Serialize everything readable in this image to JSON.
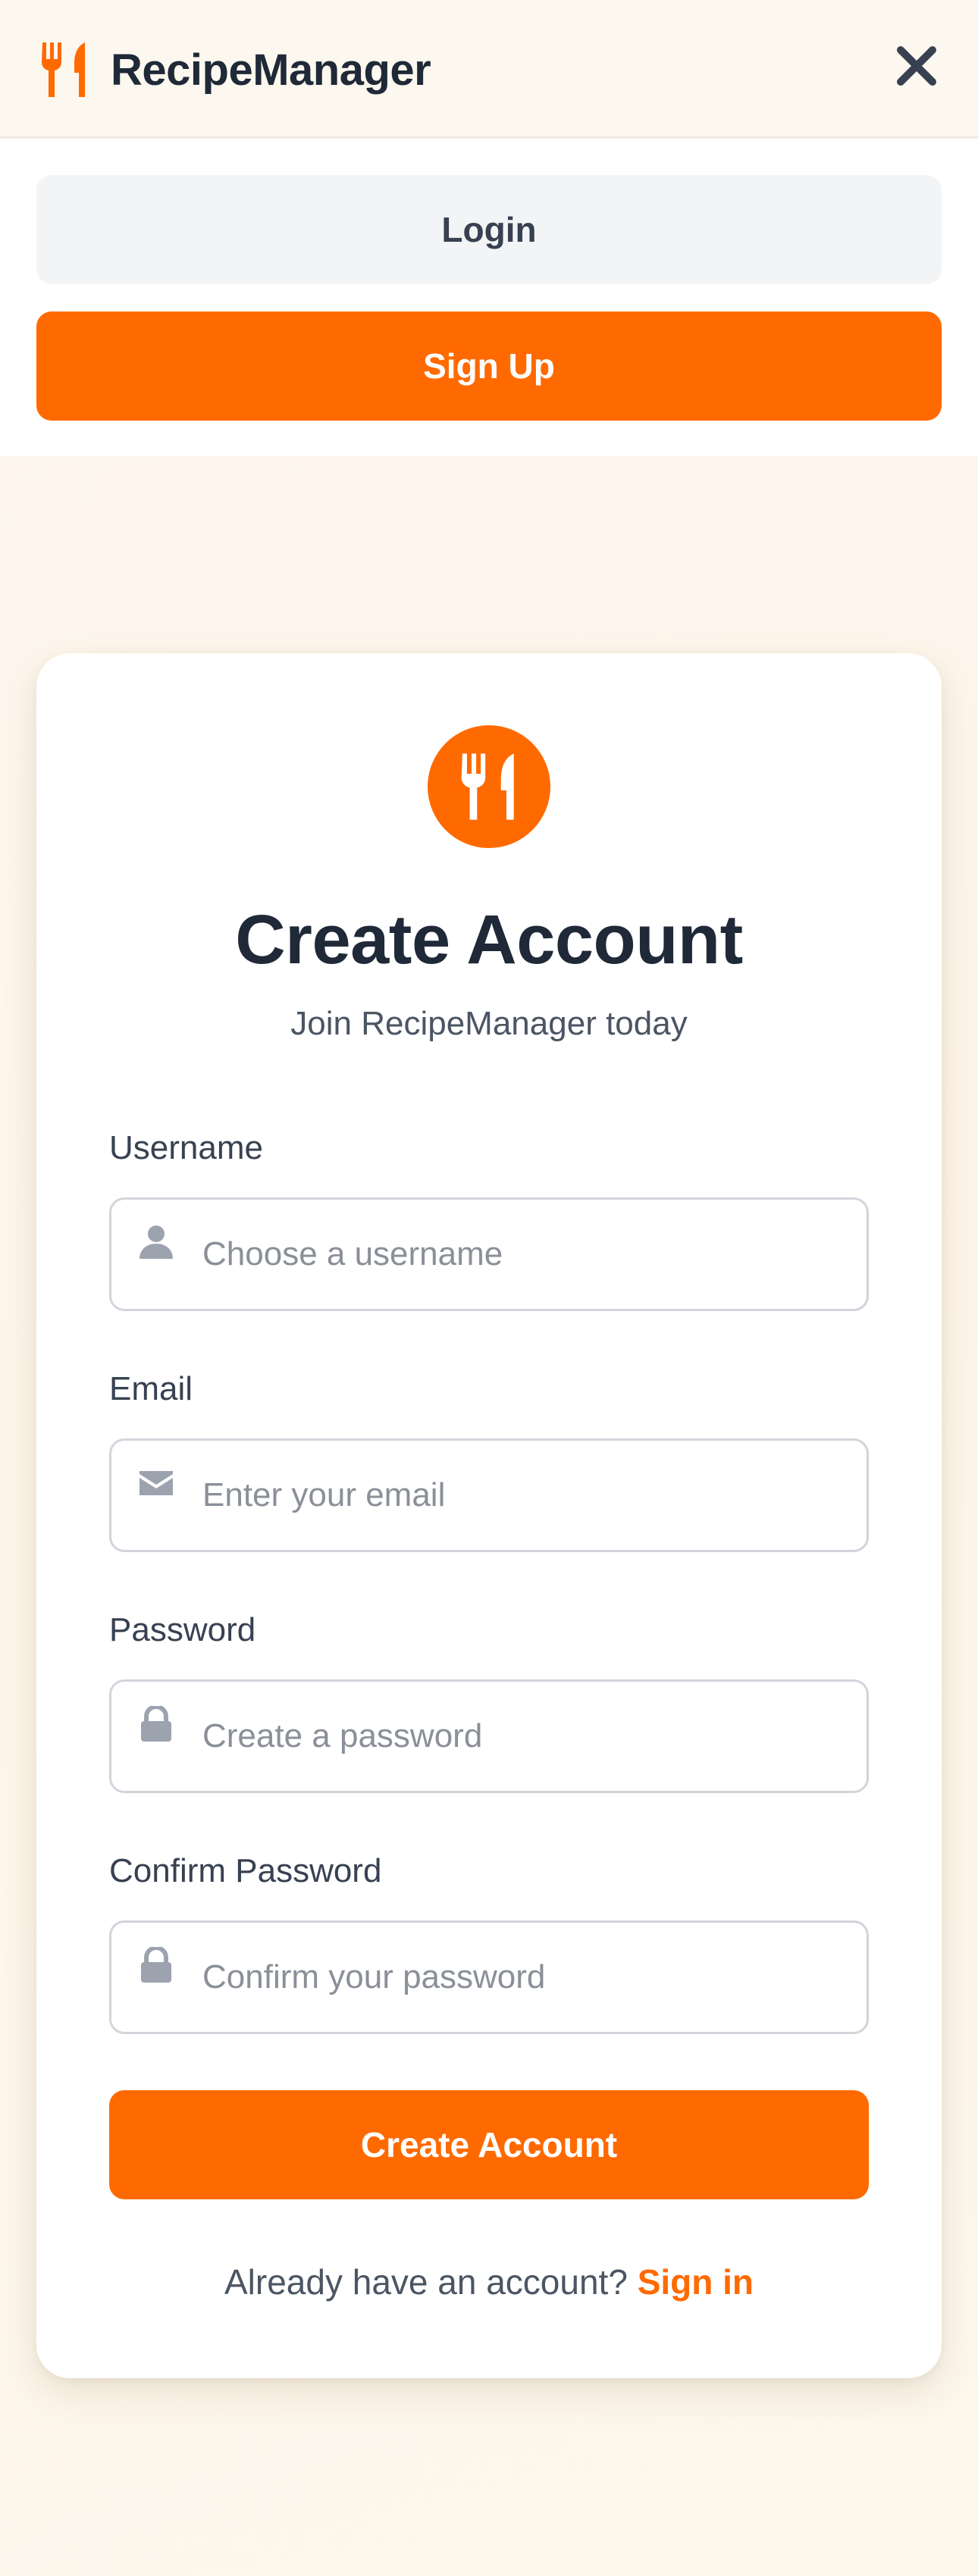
{
  "header": {
    "app_name": "RecipeManager",
    "logo_icon": "utensils-icon",
    "close_icon": "close-icon"
  },
  "menu": {
    "login_label": "Login",
    "signup_label": "Sign Up"
  },
  "card": {
    "logo_icon": "utensils-icon",
    "title": "Create Account",
    "subtitle": "Join RecipeManager today",
    "fields": [
      {
        "label": "Username",
        "placeholder": "Choose a username",
        "value": "",
        "icon": "user-icon"
      },
      {
        "label": "Email",
        "placeholder": "Enter your email",
        "value": "",
        "icon": "envelope-icon"
      },
      {
        "label": "Password",
        "placeholder": "Create a password",
        "value": "",
        "icon": "lock-icon"
      },
      {
        "label": "Confirm Password",
        "placeholder": "Confirm your password",
        "value": "",
        "icon": "lock-icon"
      }
    ],
    "submit_label": "Create Account",
    "signin_prompt": "Already have an account?",
    "signin_link": "Sign in"
  },
  "colors": {
    "accent": "#ff6a00",
    "text_dark": "#1f2937",
    "muted_icon": "#9ca3af",
    "page_bg": "#fdf7ef"
  }
}
